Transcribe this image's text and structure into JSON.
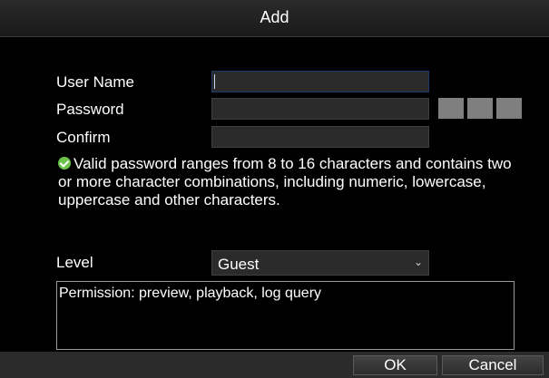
{
  "dialog": {
    "title": "Add"
  },
  "form": {
    "user_name_label": "User Name",
    "user_name_value": "",
    "password_label": "Password",
    "password_value": "",
    "confirm_label": "Confirm",
    "confirm_value": "",
    "password_note": "Valid password ranges from 8 to 16 characters and contains two or more character combinations, including numeric, lowercase, uppercase and other characters.",
    "level_label": "Level",
    "level_value": "Guest",
    "permission_text": "Permission: preview, playback, log query"
  },
  "buttons": {
    "ok_label": "OK",
    "cancel_label": "Cancel"
  },
  "icons": {
    "note_icon": "check-circle-icon",
    "dropdown_icon": "chevron-down-icon"
  },
  "colors": {
    "background": "#000000",
    "field": "#2b2b2b",
    "note_icon": "#6cc24a",
    "strength_block": "#7f7f7f"
  }
}
